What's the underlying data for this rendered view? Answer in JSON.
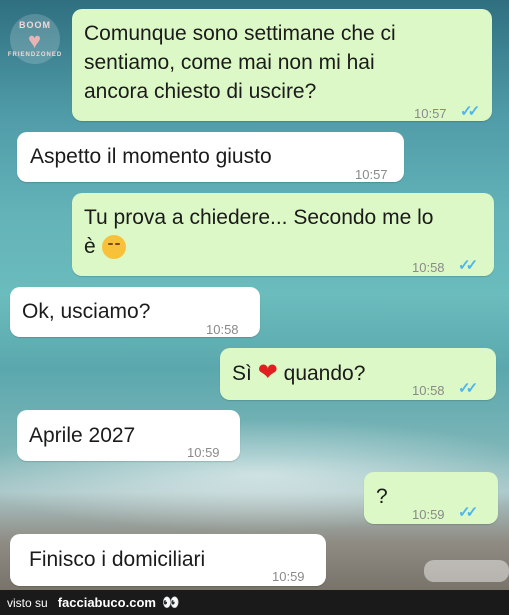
{
  "logo": {
    "top_text": "BOOM",
    "bottom_text": "FRIENDZONED"
  },
  "messages": [
    {
      "lines": [
        "Comunque sono settimane che ci",
        "sentiamo, come mai non mi hai",
        "ancora chiesto di uscire?"
      ],
      "time": "10:57",
      "direction": "outgoing",
      "status": "read"
    },
    {
      "text": "Aspetto il momento giusto",
      "time": "10:57",
      "direction": "incoming"
    },
    {
      "lines": [
        "Tu prova a chiedere... Secondo me lo",
        "è"
      ],
      "emoji": "relieved-face",
      "time": "10:58",
      "direction": "outgoing",
      "status": "read"
    },
    {
      "text": "Ok, usciamo?",
      "time": "10:58",
      "direction": "incoming"
    },
    {
      "before": "Sì",
      "emoji": "❤",
      "after": "quando?",
      "time": "10:58",
      "direction": "outgoing",
      "status": "read"
    },
    {
      "text": "Aprile 2027",
      "time": "10:59",
      "direction": "incoming"
    },
    {
      "text": "?",
      "time": "10:59",
      "direction": "outgoing",
      "status": "read"
    },
    {
      "text": "Finisco i domiciliari",
      "time": "10:59",
      "direction": "incoming"
    }
  ],
  "ticks": "✓✓",
  "footer": {
    "seen_on": "visto su",
    "site": "facciabuco.com",
    "eyes": "👀"
  },
  "colors": {
    "outgoing": "#dcf8c6",
    "incoming": "#ffffff",
    "ticks": "#4fb6ec"
  }
}
